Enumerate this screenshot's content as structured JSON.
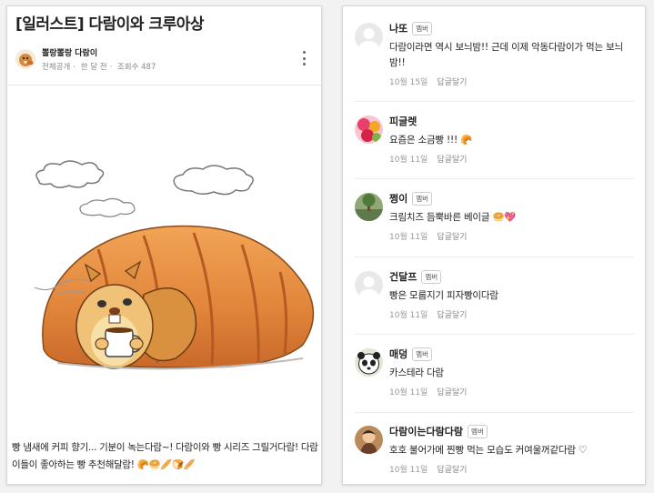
{
  "post": {
    "title": "[일러스트] 다람이와 크루아상",
    "author": "뽈랑뽈랑 다람이",
    "visibility": "전체공개",
    "time": "한 달 전",
    "views": "조회수 487",
    "body": "빵 냄새에 커피 향기... 기분이 녹는다람~! 다람이와 빵 시리즈 그릴거다람! 다람이들이 좋아하는 빵 추천해달람! 🥐🥯🥖🍞🥖"
  },
  "comments": [
    {
      "name": "나또",
      "badge": "멤버",
      "text": "다람이라면 역시 보늬밤!! 근데 이제 악동다람이가 먹는 보늬밤!!",
      "date": "10월 15일",
      "reply": "답글달기"
    },
    {
      "name": "피글렛",
      "badge": "",
      "text": "요즘은 소금빵 !!! 🥐",
      "date": "10월 11일",
      "reply": "답글달기"
    },
    {
      "name": "쩡이",
      "badge": "멤버",
      "text": "크림치즈 듬뿍바른 베이글 🥯💖",
      "date": "10월 11일",
      "reply": "답글달기"
    },
    {
      "name": "건달프",
      "badge": "멤버",
      "text": "빵은 모름지기 피자빵이다람",
      "date": "10월 11일",
      "reply": "답글달기"
    },
    {
      "name": "매덩",
      "badge": "멤버",
      "text": "카스테라 다람",
      "date": "10월 11일",
      "reply": "답글달기"
    },
    {
      "name": "다람이는다람다람",
      "badge": "멤버",
      "text": "호호 불어가메 찐빵 먹는 모습도 커여울꺼같다람 ♡",
      "date": "10월 11일",
      "reply": "답글달기"
    }
  ],
  "colors": {
    "croissant": "#e0843a",
    "squirrel": "#e9b36a",
    "text": "#222222"
  }
}
